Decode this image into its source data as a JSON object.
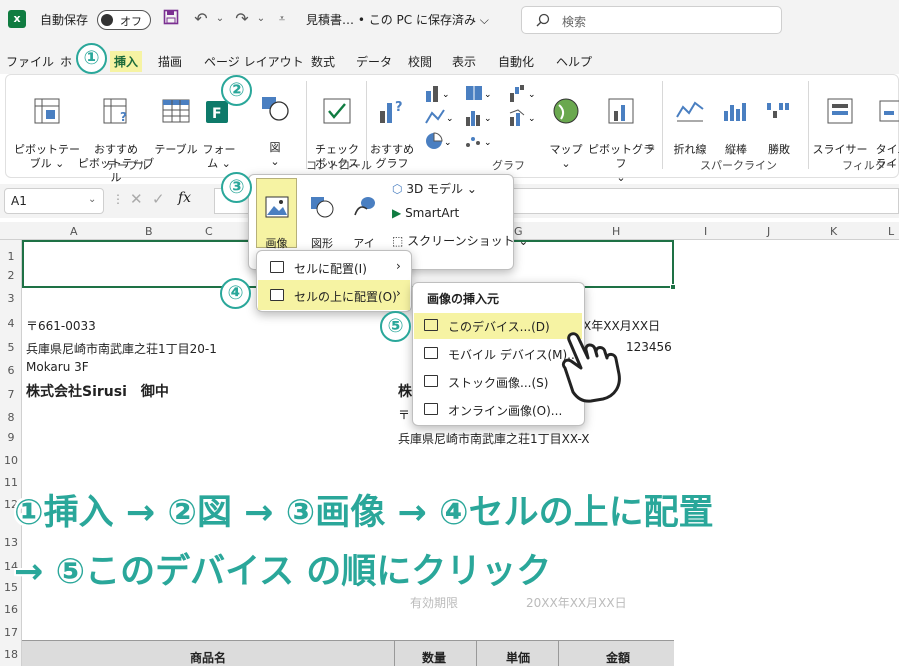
{
  "titlebar": {
    "autosave_label": "自動保存",
    "toggle_state": "オフ",
    "filename": "見積書… • この PC に保存済み ⌵",
    "search_placeholder": "検索"
  },
  "tabs": [
    "ファイル",
    "ホ",
    "挿入",
    "描画",
    "ページ レイアウト",
    "数式",
    "データ",
    "校閲",
    "表示",
    "自動化",
    "ヘルプ"
  ],
  "ribbon": {
    "buttons": {
      "pivot": "ピボットテー\nブル ⌄",
      "recommended_pivot": "おすすめ\nピボットテーブル",
      "table": "テーブル",
      "form": "フォー\nム ⌄",
      "zu": "図\n⌄",
      "checkbox": "チェック\nボックス",
      "recommended_chart": "おすすめ\nグラフ",
      "map": "マップ\n⌄",
      "pivot_chart": "ピボットグラフ\n⌄",
      "sparkline_line": "折れ線",
      "sparkline_column": "縦棒",
      "sparkline_winloss": "勝敗",
      "slicer": "スライサー",
      "timeline": "タイム\nライン"
    },
    "groups": {
      "table": "テーブル",
      "controls": "コントロール",
      "charts": "グラフ",
      "sparklines": "スパークライン",
      "filters": "フィルター"
    }
  },
  "formula_bar": {
    "name_box": "A1",
    "fx": "fx"
  },
  "columns": [
    "A",
    "B",
    "C",
    "G",
    "H",
    "I",
    "J",
    "K",
    "L"
  ],
  "rows": [
    "1",
    "2",
    "3",
    "4",
    "5",
    "6",
    "7",
    "8",
    "9",
    "10",
    "11",
    "12",
    "13",
    "14",
    "15",
    "16",
    "17",
    "18"
  ],
  "sheet": {
    "postal": "〒661-0033",
    "address": "兵庫県尼崎市南武庫之荘1丁目20-1",
    "building": "Mokaru 3F",
    "recipient": "株式会社Sirusi　御中",
    "date_right": "X年XX月XX日",
    "number_right": "123456",
    "company_right": "株",
    "postal_right": "〒",
    "address_right": "兵庫県尼崎市南武庫之荘1丁目XX-X",
    "validity_label": "有効期限",
    "validity_value": "20XX年XX月XX日",
    "table_headers": [
      "商品名",
      "数量",
      "単価",
      "金額"
    ]
  },
  "image_menu": {
    "gazo": "画像\n⌄",
    "zukei": "図形\n⌄",
    "icon": "アイ\nコン",
    "model3d": "3D モデル ⌄",
    "smartart": "SmartArt",
    "screenshot": "スクリーンショット ⌄"
  },
  "placement_menu": {
    "in_cell": "セルに配置(I)",
    "over_cell": "セルの上に配置(O)"
  },
  "source_menu": {
    "title": "画像の挿入元",
    "items": [
      "このデバイス...(D)",
      "モバイル デバイス(M)...",
      "ストック画像...(S)",
      "オンライン画像(O)..."
    ]
  },
  "steps": [
    "①",
    "②",
    "③",
    "④",
    "⑤"
  ],
  "caption": {
    "line1": "①挿入 → ②図 → ③画像 → ④セルの上に配置",
    "line2": "→ ⑤このデバイス の順にクリック"
  },
  "colors": {
    "excel_green": "#107c41",
    "highlight": "#f6f3a3",
    "teal": "#2aa79a"
  }
}
